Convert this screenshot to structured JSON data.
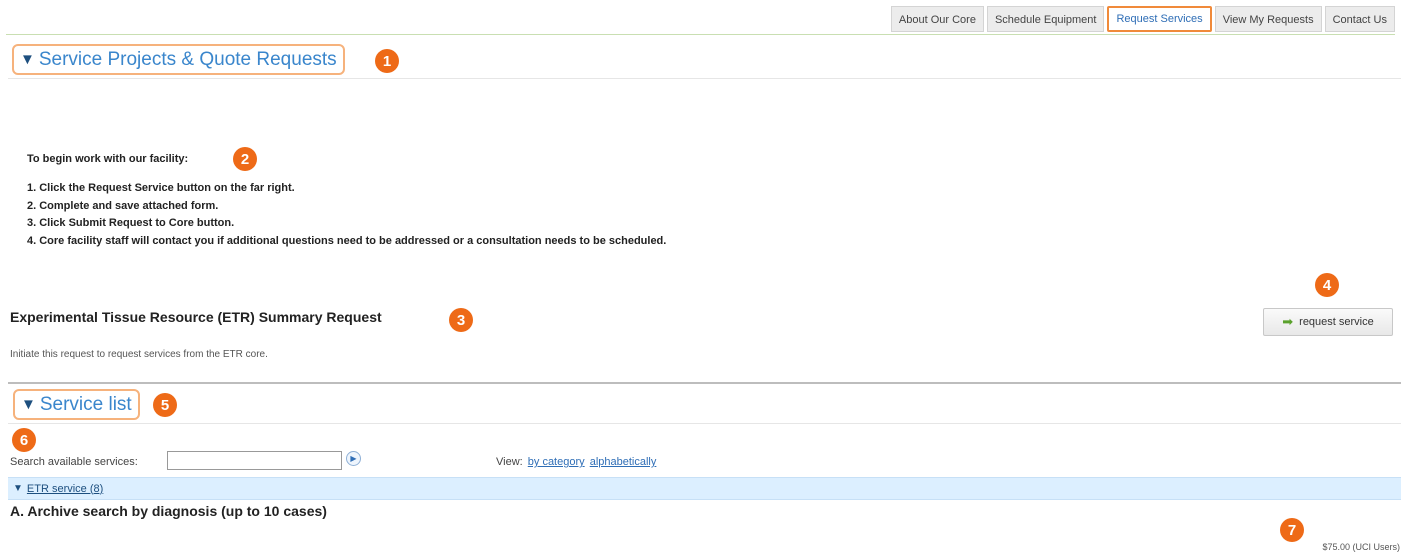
{
  "nav": {
    "tabs": [
      {
        "label": "About Our Core"
      },
      {
        "label": "Schedule Equipment"
      },
      {
        "label": "Request Services",
        "active": true
      },
      {
        "label": "View My Requests"
      },
      {
        "label": "Contact Us"
      }
    ]
  },
  "sections": {
    "service_projects": {
      "title": "Service Projects & Quote Requests",
      "expanded": true
    },
    "service_list": {
      "title": "Service list",
      "expanded": true
    }
  },
  "intro": {
    "heading": "To begin work with our facility:",
    "steps": [
      "1. Click the Request Service button on the far right.",
      "2. Complete and save attached form.",
      "3. Click Submit Request to Core button.",
      "4. Core facility staff will contact you if additional questions need to be addressed or a consultation needs to be scheduled."
    ]
  },
  "request": {
    "title": "Experimental Tissue Resource (ETR) Summary Request",
    "description": "Initiate this request to request services from the ETR core.",
    "button_label": "request service"
  },
  "search": {
    "label": "Search available services:",
    "value": "",
    "view_label": "View:",
    "view_by_category": "by category",
    "view_alphabetically": "alphabetically"
  },
  "category": {
    "label": "ETR service (8)"
  },
  "items": [
    {
      "title": "A. Archive search by diagnosis (up to 10 cases)",
      "price": "$75.00 (UCI Users)"
    }
  ],
  "badges": [
    "1",
    "2",
    "3",
    "4",
    "5",
    "6",
    "7"
  ],
  "colors": {
    "accent": "#3a86cc",
    "badge": "#ee6a17",
    "highlight": "#f6b27c",
    "category_bar": "#dcefff"
  }
}
